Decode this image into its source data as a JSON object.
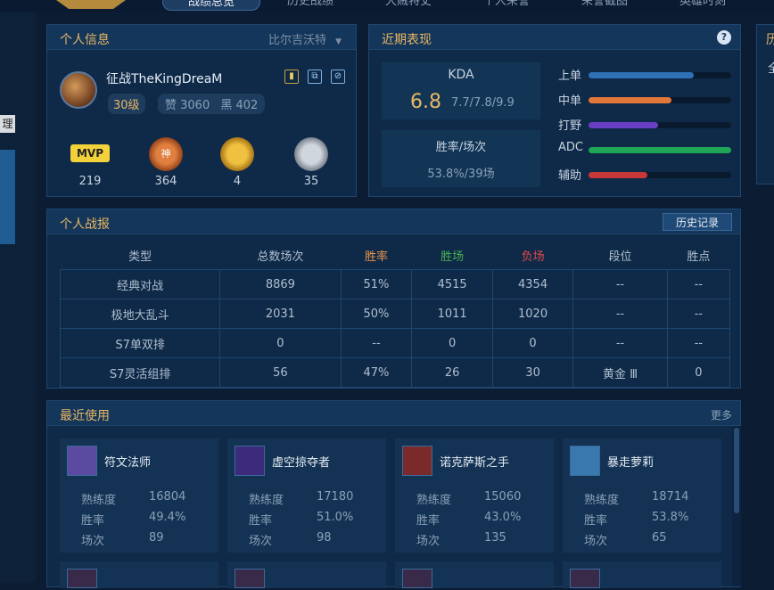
{
  "top_tabs": {
    "overview": "战绩总览",
    "history": "历史战绩",
    "honors": "大贼特丈",
    "personal": "个人荣誉",
    "screenshots": "荣誉截图",
    "moments": "英雄时刻"
  },
  "left_nav": {
    "label": "理"
  },
  "profile": {
    "title": "个人信息",
    "server": "比尔吉沃特",
    "name": "征战TheKingDreaM",
    "level": "30级",
    "likes": "赞 3060",
    "blacks": "黑 402",
    "medals": [
      {
        "name": "mvp",
        "label": "MVP",
        "count": "219"
      },
      {
        "name": "god",
        "label": "神",
        "count": "364"
      },
      {
        "name": "gold",
        "label": "",
        "count": "4"
      },
      {
        "name": "silver",
        "label": "",
        "count": "35"
      }
    ]
  },
  "recent": {
    "title": "近期表现",
    "help": "?",
    "kda_label": "KDA",
    "kda_value": "6.8",
    "kda_detail": "7.7/7.8/9.9",
    "winrate_label": "胜率/场次",
    "winrate_value": "53.8%/39场",
    "lanes": [
      {
        "name": "上单",
        "pct": 0.74,
        "color": "#2f70b6"
      },
      {
        "name": "中单",
        "pct": 0.58,
        "color": "#e2773a"
      },
      {
        "name": "打野",
        "pct": 0.49,
        "color": "#6a3ec4"
      },
      {
        "name": "ADC",
        "pct": 1.0,
        "color": "#1fa657"
      },
      {
        "name": "辅助",
        "pct": 0.41,
        "color": "#c93838"
      }
    ]
  },
  "report": {
    "title": "个人战报",
    "history_button": "历史记录",
    "headers": [
      "类型",
      "总数场次",
      "胜率",
      "胜场",
      "负场",
      "段位",
      "胜点"
    ],
    "header_colors": [
      "#b0bfd0",
      "#b0bfd0",
      "#e8944a",
      "#4caf50",
      "#e04848",
      "#b0bfd0",
      "#b0bfd0"
    ],
    "rows": [
      [
        "经典对战",
        "8869",
        "51%",
        "4515",
        "4354",
        "--",
        "--"
      ],
      [
        "极地大乱斗",
        "2031",
        "50%",
        "1011",
        "1020",
        "--",
        "--"
      ],
      [
        "S7单双排",
        "0",
        "--",
        "0",
        "0",
        "--",
        "--"
      ],
      [
        "S7灵活组排",
        "56",
        "47%",
        "26",
        "30",
        "黄金 Ⅲ",
        "0"
      ]
    ]
  },
  "recent_used": {
    "title": "最近使用",
    "more": "更多",
    "heroes": [
      {
        "name": "符文法师",
        "avatar_color": "#5a4aa0",
        "mastery_label": "熟练度",
        "mastery": "16804",
        "winrate_label": "胜率",
        "winrate": "49.4%",
        "games_label": "场次",
        "games": "89"
      },
      {
        "name": "虚空掠夺者",
        "avatar_color": "#3c2a7a",
        "mastery_label": "熟练度",
        "mastery": "17180",
        "winrate_label": "胜率",
        "winrate": "51.0%",
        "games_label": "场次",
        "games": "98"
      },
      {
        "name": "诺克萨斯之手",
        "avatar_color": "#7a2a2a",
        "mastery_label": "熟练度",
        "mastery": "15060",
        "winrate_label": "胜率",
        "winrate": "43.0%",
        "games_label": "场次",
        "games": "135"
      },
      {
        "name": "暴走萝莉",
        "avatar_color": "#3a78b0",
        "mastery_label": "熟练度",
        "mastery": "18714",
        "winrate_label": "胜率",
        "winrate": "53.8%",
        "games_label": "场次",
        "games": "65"
      }
    ]
  },
  "right_stub": {
    "title": "历",
    "text": "全"
  }
}
